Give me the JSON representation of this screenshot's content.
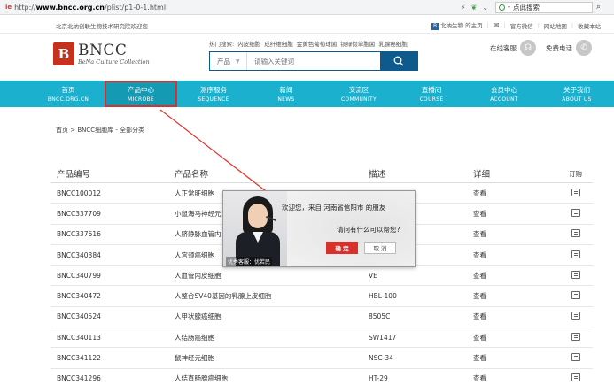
{
  "browser": {
    "badge": "ie",
    "url_prefix": "http://",
    "url_domain": "www.bncc.org.cn",
    "url_path": "/plist/p1-0-1.html",
    "search_placeholder": "点此搜索"
  },
  "topbar": {
    "company": "北京北纳创联生物技术研究院欢迎您",
    "home_label": "北纳生物 的主页",
    "links": [
      "官方微信",
      "网站地图",
      "收藏本站"
    ]
  },
  "logo": {
    "mark": "B",
    "name": "BNCC",
    "subtitle": "BeNa Culture Collection"
  },
  "hot_search": {
    "label": "热门搜索:",
    "items": [
      "内皮细胞",
      "成纤维细胞",
      "金黄色葡萄球菌",
      "铜绿假单胞菌",
      "乳腺癌细胞"
    ]
  },
  "search": {
    "category": "产品",
    "placeholder": "请输入关键词"
  },
  "contact": {
    "online": "在线客服",
    "phone": "免费电话"
  },
  "nav": [
    {
      "cn": "首页",
      "en": "BNCC.ORG.CN"
    },
    {
      "cn": "产品中心",
      "en": "MICROBE"
    },
    {
      "cn": "测序服务",
      "en": "SEQUENCE"
    },
    {
      "cn": "新闻",
      "en": "NEWS"
    },
    {
      "cn": "交流区",
      "en": "COMMUNITY"
    },
    {
      "cn": "直播间",
      "en": "COURSE"
    },
    {
      "cn": "会员中心",
      "en": "ACCOUNT"
    },
    {
      "cn": "关于我们",
      "en": "ABOUT US"
    }
  ],
  "breadcrumb": "首页 > BNCC细胞库 - 全部分类",
  "table": {
    "headers": [
      "产品编号",
      "产品名称",
      "描述",
      "详细",
      "订购"
    ],
    "rows": [
      {
        "id": "BNCC100012",
        "name": "人正常肝细胞",
        "desc": "",
        "detail": "查看"
      },
      {
        "id": "BNCC337709",
        "name": "小鼠海马神经元",
        "desc": "",
        "detail": "查看"
      },
      {
        "id": "BNCC337616",
        "name": "人脐静脉血管内",
        "desc": "",
        "detail": "查看"
      },
      {
        "id": "BNCC340384",
        "name": "人宫颈癌细胞",
        "desc": "",
        "detail": "查看"
      },
      {
        "id": "BNCC340799",
        "name": "人血管内皮细胞",
        "desc": "VE",
        "detail": "查看"
      },
      {
        "id": "BNCC340472",
        "name": "人整合SV40基因的乳腺上皮细胞",
        "desc": "HBL-100",
        "detail": "查看"
      },
      {
        "id": "BNCC340524",
        "name": "人甲状腺癌细胞",
        "desc": "8505C",
        "detail": "查看"
      },
      {
        "id": "BNCC340113",
        "name": "人结肠癌细胞",
        "desc": "SW1417",
        "detail": "查看"
      },
      {
        "id": "BNCC341122",
        "name": "鼠神经元细胞",
        "desc": "NSC-34",
        "detail": "查看"
      },
      {
        "id": "BNCC341296",
        "name": "人结直肠腺癌细胞",
        "desc": "HT-29",
        "detail": "查看"
      }
    ]
  },
  "chat_popup": {
    "greeting": "欢迎您，来自 河南省信阳市 的朋友",
    "question": "请问有什么可以帮您?",
    "ok": "确  定",
    "cancel": "取  消",
    "agent_caption": "优秀客服：优若民"
  },
  "colors": {
    "nav": "#1bb0cd",
    "brand_red": "#c8301e",
    "search_blue": "#0f5a8c",
    "highlight": "#d8302a"
  }
}
